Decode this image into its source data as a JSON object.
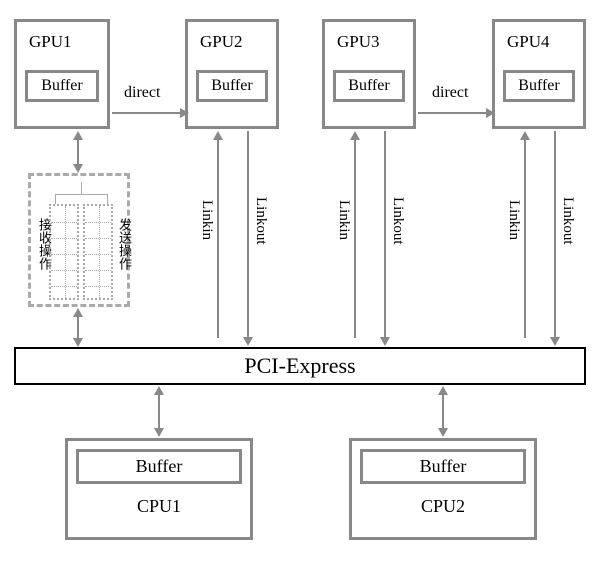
{
  "gpus": [
    {
      "name": "GPU1",
      "buffer": "Buffer"
    },
    {
      "name": "GPU2",
      "buffer": "Buffer"
    },
    {
      "name": "GPU3",
      "buffer": "Buffer"
    },
    {
      "name": "GPU4",
      "buffer": "Buffer"
    }
  ],
  "direct_labels": [
    "direct",
    "direct"
  ],
  "link_labels": {
    "in": "Linkin",
    "out": "Linkout"
  },
  "bus": "PCI-Express",
  "cpus": [
    {
      "name": "CPU1",
      "buffer": "Buffer"
    },
    {
      "name": "CPU2",
      "buffer": "Buffer"
    }
  ],
  "ops": {
    "recv": "接收操作",
    "send": "发送操作"
  }
}
